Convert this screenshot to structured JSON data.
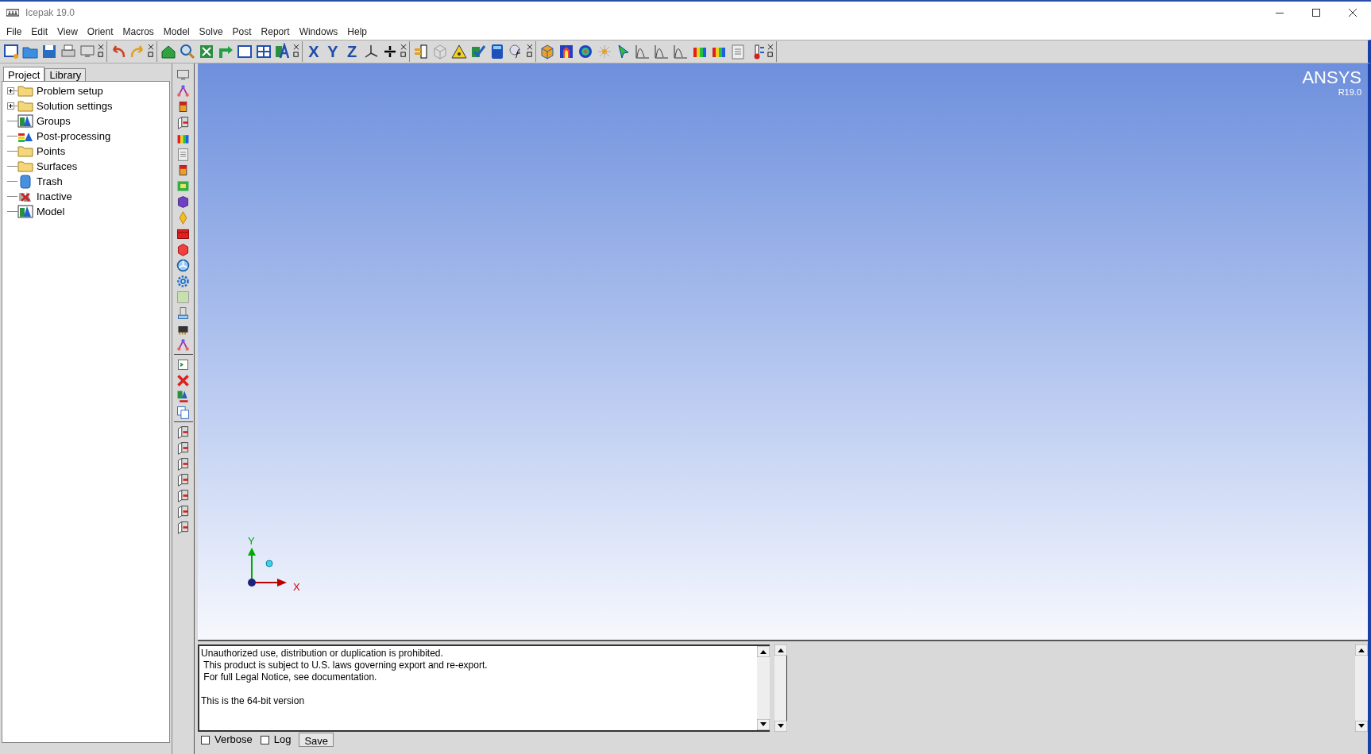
{
  "window": {
    "title": "Icepak 19.0"
  },
  "menu": [
    "File",
    "Edit",
    "View",
    "Orient",
    "Macros",
    "Model",
    "Solve",
    "Post",
    "Report",
    "Windows",
    "Help"
  ],
  "orient_buttons": [
    "X",
    "Y",
    "Z"
  ],
  "tabs": [
    {
      "label": "Project",
      "selected": true
    },
    {
      "label": "Library",
      "selected": false
    }
  ],
  "tree": [
    {
      "label": "Problem setup",
      "kind": "folder",
      "expandable": true
    },
    {
      "label": "Solution settings",
      "kind": "folder",
      "expandable": true
    },
    {
      "label": "Groups",
      "kind": "groups",
      "expandable": false
    },
    {
      "label": "Post-processing",
      "kind": "post",
      "expandable": false
    },
    {
      "label": "Points",
      "kind": "folder",
      "expandable": false
    },
    {
      "label": "Surfaces",
      "kind": "folder",
      "expandable": false
    },
    {
      "label": "Trash",
      "kind": "trash",
      "expandable": false
    },
    {
      "label": "Inactive",
      "kind": "inactive",
      "expandable": false
    },
    {
      "label": "Model",
      "kind": "groups",
      "expandable": false
    }
  ],
  "viewport": {
    "logo": "ANSYS",
    "version": "R19.0",
    "axis_y": "Y",
    "axis_x": "X"
  },
  "console": {
    "lines": [
      "Unauthorized use, distribution or duplication is prohibited.",
      " This product is subject to U.S. laws governing export and re-export.",
      " For full Legal Notice, see documentation."
    ],
    "version_line": "This is the 64-bit version"
  },
  "options": [
    {
      "label": "Verbose",
      "checked": false
    },
    {
      "label": "Log",
      "checked": false
    }
  ],
  "save_button": "Save"
}
